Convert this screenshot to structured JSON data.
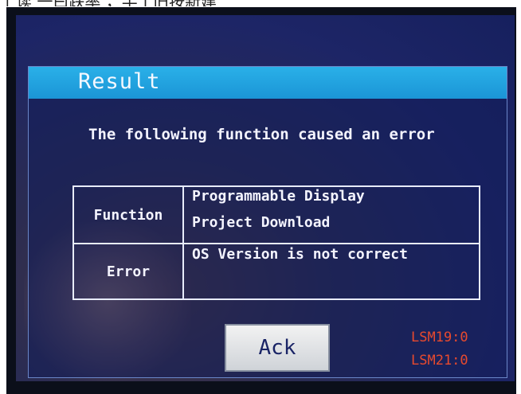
{
  "page_top_text": "上读 一曰跌率 ，半 | 旧按新建",
  "dialog": {
    "title": "Result",
    "message": "The following function caused an error",
    "table": {
      "rows": [
        {
          "label": "Function",
          "value_lines": [
            "Programmable Display",
            "Project Download"
          ]
        },
        {
          "label": "Error",
          "value_lines": [
            "OS Version is not correct"
          ]
        }
      ]
    },
    "ack_label": "Ack"
  },
  "status": {
    "lsm1": "LSM19:0",
    "lsm2": "LSM21:0"
  },
  "colors": {
    "title_bar": "#1b95d6",
    "screen_bg": "#1d2566",
    "status_text": "#e84a2e"
  }
}
